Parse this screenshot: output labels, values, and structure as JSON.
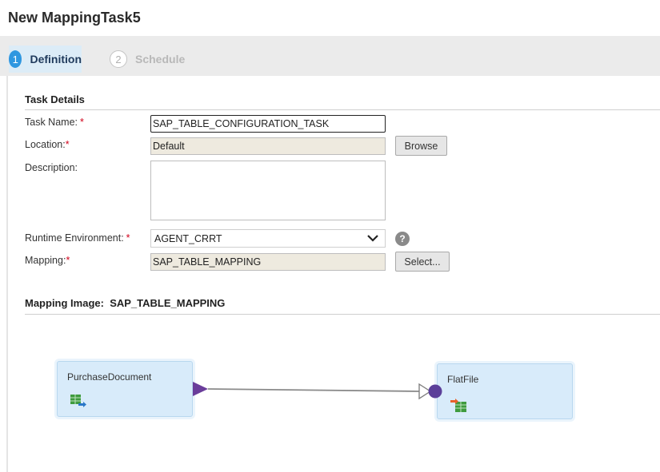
{
  "page": {
    "title": "New MappingTask5"
  },
  "steps": [
    {
      "number": "1",
      "label": "Definition",
      "active": true
    },
    {
      "number": "2",
      "label": "Schedule",
      "active": false
    }
  ],
  "task_details": {
    "title": "Task Details",
    "task_name": {
      "label": "Task Name:",
      "required": "*",
      "value": "SAP_TABLE_CONFIGURATION_TASK"
    },
    "location": {
      "label": "Location:",
      "required": "*",
      "value": "Default",
      "button": "Browse"
    },
    "description": {
      "label": "Description:",
      "value": ""
    },
    "runtime": {
      "label": "Runtime Environment:",
      "required": "*",
      "value": "AGENT_CRRT",
      "help": "?"
    },
    "mapping": {
      "label": "Mapping:",
      "required": "*",
      "value": "SAP_TABLE_MAPPING",
      "button": "Select..."
    }
  },
  "mapping_image": {
    "title_prefix": "Mapping Image:",
    "title_value": "SAP_TABLE_MAPPING",
    "source_node": {
      "label": "PurchaseDocument",
      "icon": "source-table-icon"
    },
    "target_node": {
      "label": "FlatFile",
      "icon": "target-file-icon"
    }
  },
  "colors": {
    "accent": "#2f97e0",
    "required": "#d0021b",
    "node_fill": "#d8ebfa",
    "connector_out": "#6a3d9a",
    "connector_in": "#5b3f99"
  }
}
